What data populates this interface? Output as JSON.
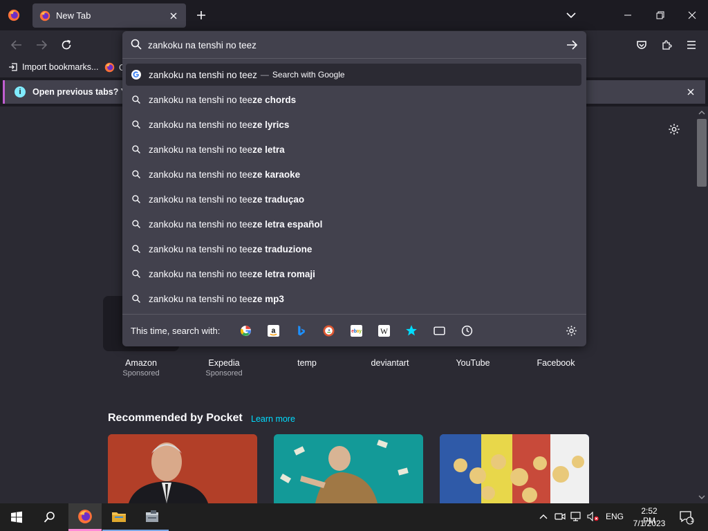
{
  "tab": {
    "title": "New Tab"
  },
  "bookmarks": {
    "import_label": "Import bookmarks...",
    "g_label": "G"
  },
  "notification": {
    "text": "Open previous tabs? You"
  },
  "urlbar": {
    "value": "zankoku na tenshi no teez"
  },
  "suggestions": {
    "first": {
      "text": "zankoku na tenshi no teez",
      "separator": "—",
      "action": "Search with Google"
    },
    "items": [
      {
        "prefix": "zankoku na tenshi no tee",
        "suffix": "ze chords"
      },
      {
        "prefix": "zankoku na tenshi no tee",
        "suffix": "ze lyrics"
      },
      {
        "prefix": "zankoku na tenshi no tee",
        "suffix": "ze letra"
      },
      {
        "prefix": "zankoku na tenshi no tee",
        "suffix": "ze karaoke"
      },
      {
        "prefix": "zankoku na tenshi no tee",
        "suffix": "ze traduçao"
      },
      {
        "prefix": "zankoku na tenshi no tee",
        "suffix": "ze letra español"
      },
      {
        "prefix": "zankoku na tenshi no tee",
        "suffix": "ze traduzione"
      },
      {
        "prefix": "zankoku na tenshi no tee",
        "suffix": "ze letra romaji"
      },
      {
        "prefix": "zankoku na tenshi no tee",
        "suffix": "ze mp3"
      }
    ]
  },
  "oneoff": {
    "label": "This time, search with:",
    "engines": [
      "google-icon",
      "amazon-icon",
      "bing-icon",
      "duckduckgo-icon",
      "ebay-icon",
      "wikipedia-icon",
      "bookmarks-star-icon",
      "tabs-icon",
      "history-clock-icon"
    ]
  },
  "tiles": [
    {
      "label": "Amazon",
      "sub": "Sponsored"
    },
    {
      "label": "Expedia",
      "sub": "Sponsored"
    },
    {
      "label": "temp",
      "sub": ""
    },
    {
      "label": "deviantart",
      "sub": ""
    },
    {
      "label": "YouTube",
      "sub": ""
    },
    {
      "label": "Facebook",
      "sub": ""
    }
  ],
  "pocket": {
    "title": "Recommended by Pocket",
    "learn_more": "Learn more"
  },
  "taskbar": {
    "lang": "ENG",
    "time": "2:52 PM",
    "date": "7/1/2023",
    "notif_count": "1"
  },
  "colors": {
    "accent": "#00ddff",
    "notif_border": "#c05ed0",
    "selected_row": "#2b2a33",
    "panel": "#42414d"
  }
}
